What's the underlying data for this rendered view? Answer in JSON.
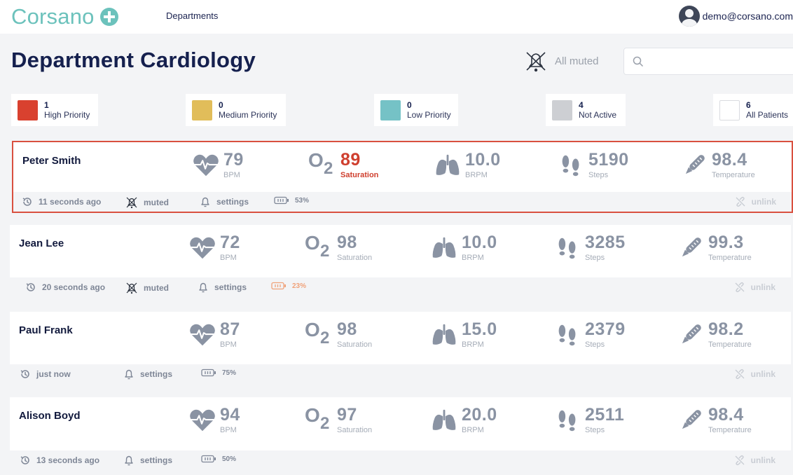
{
  "app": {
    "logo_text": "Corsano",
    "nav_link": "Departments",
    "user_email": "demo@corsano.com"
  },
  "header": {
    "title": "Department Cardiology",
    "mute_label": "All muted",
    "search_placeholder": ""
  },
  "filters": [
    {
      "count": "1",
      "label": "High Priority",
      "color": "#d9412f"
    },
    {
      "count": "0",
      "label": "Medium Priority",
      "color": "#e1bd5a"
    },
    {
      "count": "0",
      "label": "Low Priority",
      "color": "#75c2c6"
    },
    {
      "count": "4",
      "label": "Not Active",
      "color": "#cdcfd3"
    },
    {
      "count": "6",
      "label": "All Patients",
      "color": "#ffffff"
    }
  ],
  "patients": [
    {
      "name": "Peter Smith",
      "bpm": "79",
      "bpm_label": "BPM",
      "o2": "89",
      "o2_label": "Saturation",
      "brpm": "10.0",
      "brpm_label": "BRPM",
      "steps": "5190",
      "steps_label": "Steps",
      "temp": "98.4",
      "temp_label": "Temperature",
      "last_seen": "11 seconds ago",
      "muted_label": "muted",
      "settings_label": "settings",
      "battery": "53%",
      "unlink_label": "unlink"
    },
    {
      "name": "Jean Lee",
      "bpm": "72",
      "bpm_label": "BPM",
      "o2": "98",
      "o2_label": "Saturation",
      "brpm": "10.0",
      "brpm_label": "BRPM",
      "steps": "3285",
      "steps_label": "Steps",
      "temp": "99.3",
      "temp_label": "Temperature",
      "last_seen": "20 seconds ago",
      "muted_label": "muted",
      "settings_label": "settings",
      "battery": "23%",
      "unlink_label": "unlink"
    },
    {
      "name": "Paul Frank",
      "bpm": "87",
      "bpm_label": "BPM",
      "o2": "98",
      "o2_label": "Saturation",
      "brpm": "15.0",
      "brpm_label": "BRPM",
      "steps": "2379",
      "steps_label": "Steps",
      "temp": "98.2",
      "temp_label": "Temperature",
      "last_seen": "just now",
      "settings_label": "settings",
      "battery": "75%",
      "unlink_label": "unlink"
    },
    {
      "name": "Alison Boyd",
      "bpm": "94",
      "bpm_label": "BPM",
      "o2": "97",
      "o2_label": "Saturation",
      "brpm": "20.0",
      "brpm_label": "BRPM",
      "steps": "2511",
      "steps_label": "Steps",
      "temp": "98.4",
      "temp_label": "Temperature",
      "last_seen": "13 seconds ago",
      "settings_label": "settings",
      "battery": "50%",
      "unlink_label": "unlink"
    }
  ],
  "icons": {
    "logo": "plus-circle-icon",
    "avatar": "user-avatar-icon",
    "mute": "muted-bell-icon",
    "search": "search-icon",
    "heart": "heart-rate-icon",
    "lungs": "lungs-icon",
    "steps": "footsteps-icon",
    "thermometer": "thermometer-icon",
    "history": "history-icon",
    "bell": "bell-icon",
    "battery": "battery-icon",
    "unlink": "unlink-icon"
  },
  "colors": {
    "brand": "#6cc2bc",
    "alert": "#d9503f",
    "title": "#15204e",
    "muted_text": "#8a93a3",
    "battery_low": "#f0a27a"
  }
}
